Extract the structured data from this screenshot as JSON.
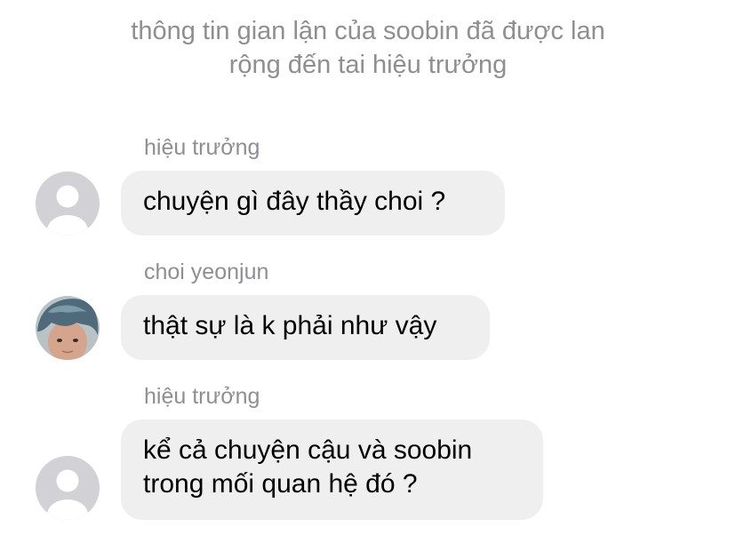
{
  "system_note": {
    "line1": "thông tin gian lận của soobin đã được lan",
    "line2": "rộng đến tai hiệu trưởng"
  },
  "messages": [
    {
      "sender": "hiệu trưởng",
      "avatar": "default-avatar-icon",
      "lines": [
        "chuyện gì đây thầy choi ?"
      ]
    },
    {
      "sender": "choi yeonjun",
      "avatar": "profile-photo",
      "lines": [
        "thật sự là k phải như vậy"
      ]
    },
    {
      "sender": "hiệu trưởng",
      "avatar": "default-avatar-icon",
      "lines": [
        "kể cả chuyện cậu và soobin",
        "trong mối quan hệ đó ?"
      ]
    }
  ],
  "colors": {
    "bubble": "#efeff0",
    "meta_text": "#8e8e93",
    "avatar_bg": "#d1d1d6"
  }
}
